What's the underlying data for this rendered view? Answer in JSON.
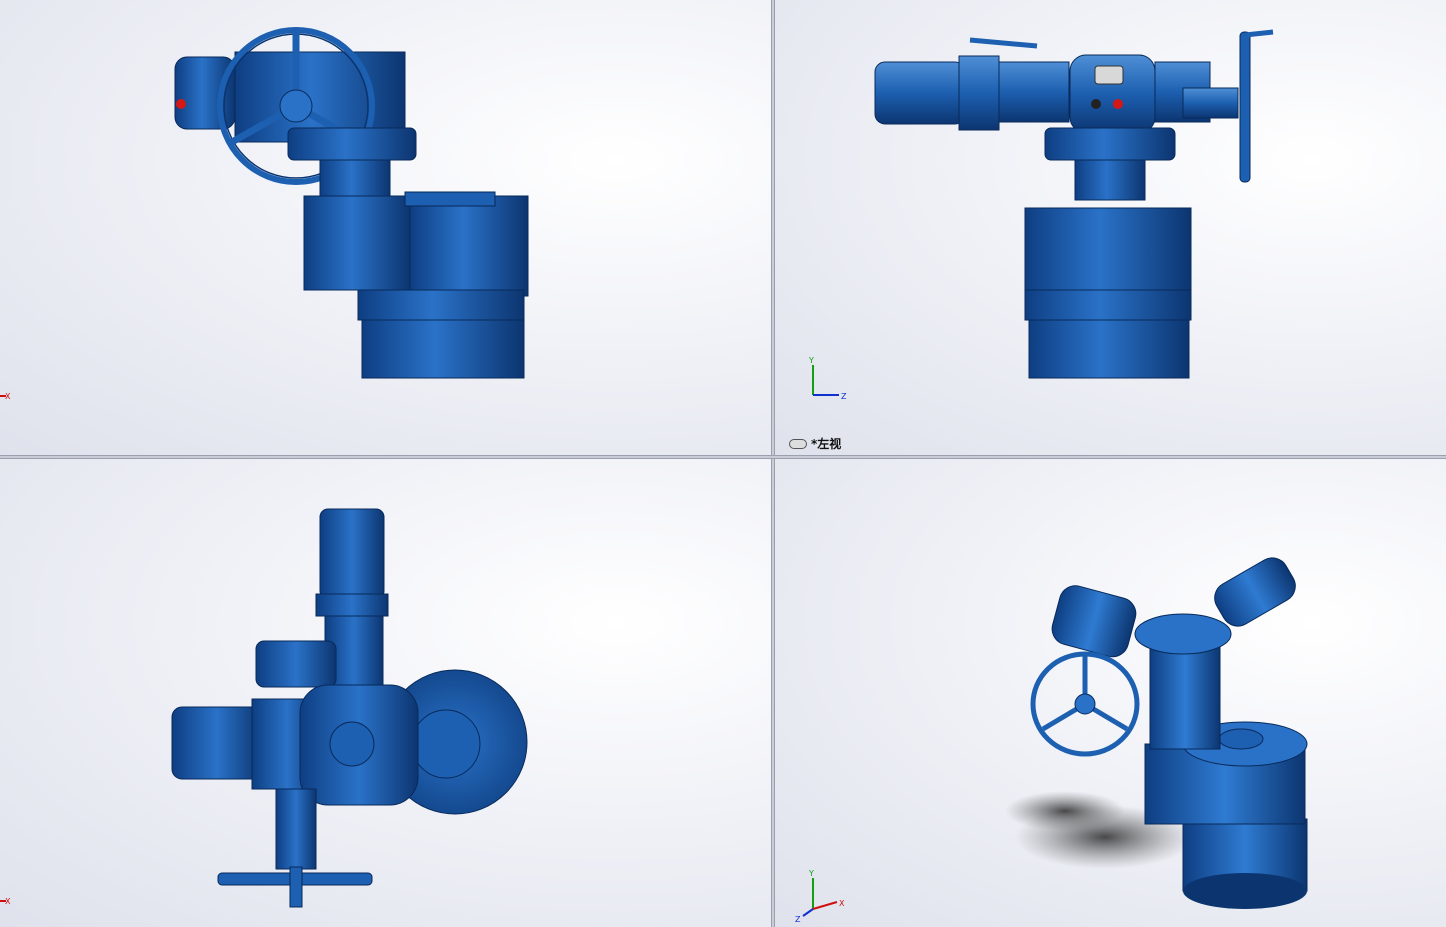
{
  "viewports": {
    "top_left": {
      "axis_x": "X"
    },
    "top_right": {
      "view_name": "*左视",
      "axis_y": "Y",
      "axis_z": "Z"
    },
    "bottom_left": {
      "axis_x": "X"
    },
    "bottom_right": {
      "axis_y": "Y",
      "axis_z": "Z",
      "axis_x": "X"
    }
  },
  "colors": {
    "model_blue": "#1d5fb0",
    "model_dark": "#0d3a78",
    "model_light": "#4f8fd6",
    "indicator_red": "#d41818",
    "axis_red": "#d01010",
    "axis_green": "#10a010",
    "axis_blue": "#1030d0"
  }
}
